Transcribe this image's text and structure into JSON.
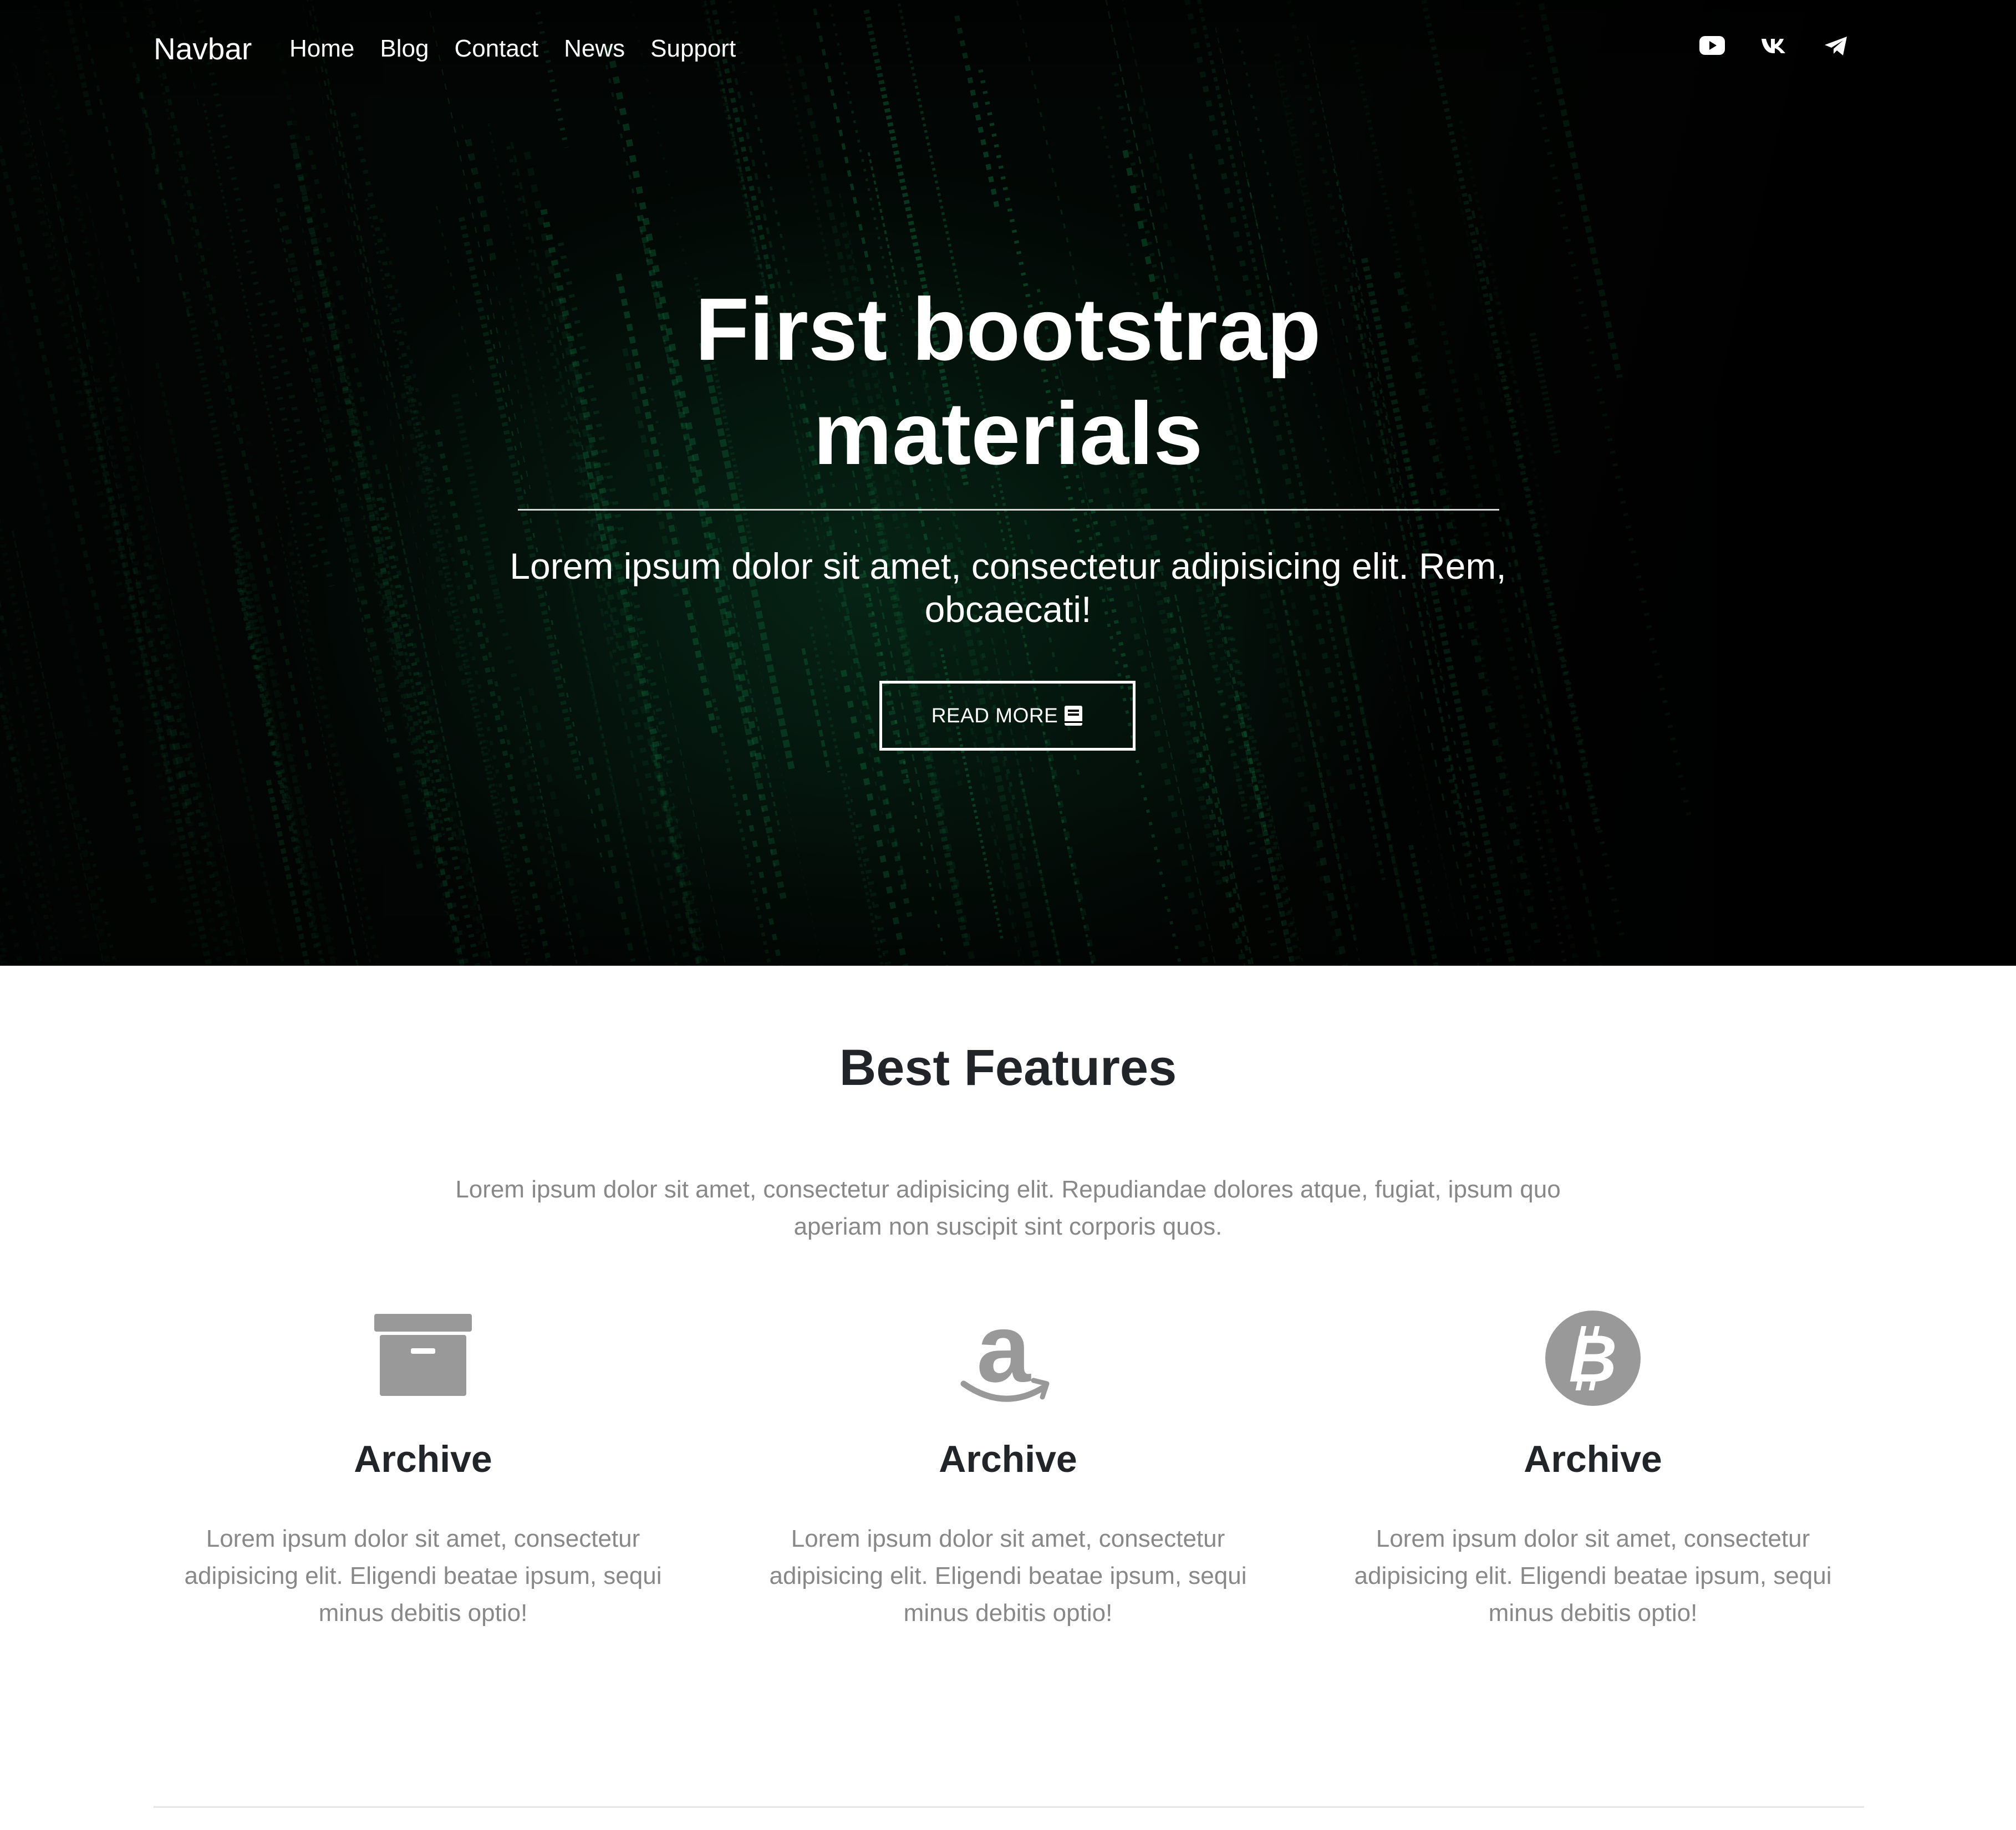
{
  "navbar": {
    "brand": "Navbar",
    "links": [
      "Home",
      "Blog",
      "Contact",
      "News",
      "Support"
    ],
    "social_icons": [
      "youtube-icon",
      "vk-icon",
      "telegram-icon"
    ]
  },
  "hero": {
    "title": "First bootstrap materials",
    "lead": "Lorem ipsum dolor sit amet, consectetur adipisicing elit. Rem, obcaecati!",
    "button": {
      "label": "READ MORE",
      "icon": "book-icon"
    }
  },
  "features": {
    "title": "Best Features",
    "description": "Lorem ipsum dolor sit amet, consectetur adipisicing elit. Repudiandae dolores atque, fugiat, ipsum quo aperiam non suscipit sint corporis quos.",
    "items": [
      {
        "icon": "archive-box-icon",
        "title": "Archive",
        "text": "Lorem ipsum dolor sit amet, consectetur adipisicing elit. Eligendi beatae ipsum, sequi minus debitis optio!"
      },
      {
        "icon": "amazon-icon",
        "title": "Archive",
        "text": "Lorem ipsum dolor sit amet, consectetur adipisicing elit. Eligendi beatae ipsum, sequi minus debitis optio!"
      },
      {
        "icon": "bitcoin-icon",
        "title": "Archive",
        "text": "Lorem ipsum dolor sit amet, consectetur adipisicing elit. Eligendi beatae ipsum, sequi minus debitis optio!"
      }
    ]
  },
  "colors": {
    "hero_bg": "#020604",
    "hero_green": "#0f6b3a",
    "text_white": "#ffffff",
    "heading_dark": "#212529",
    "muted_text": "#888888",
    "icon_gray": "#999999"
  }
}
